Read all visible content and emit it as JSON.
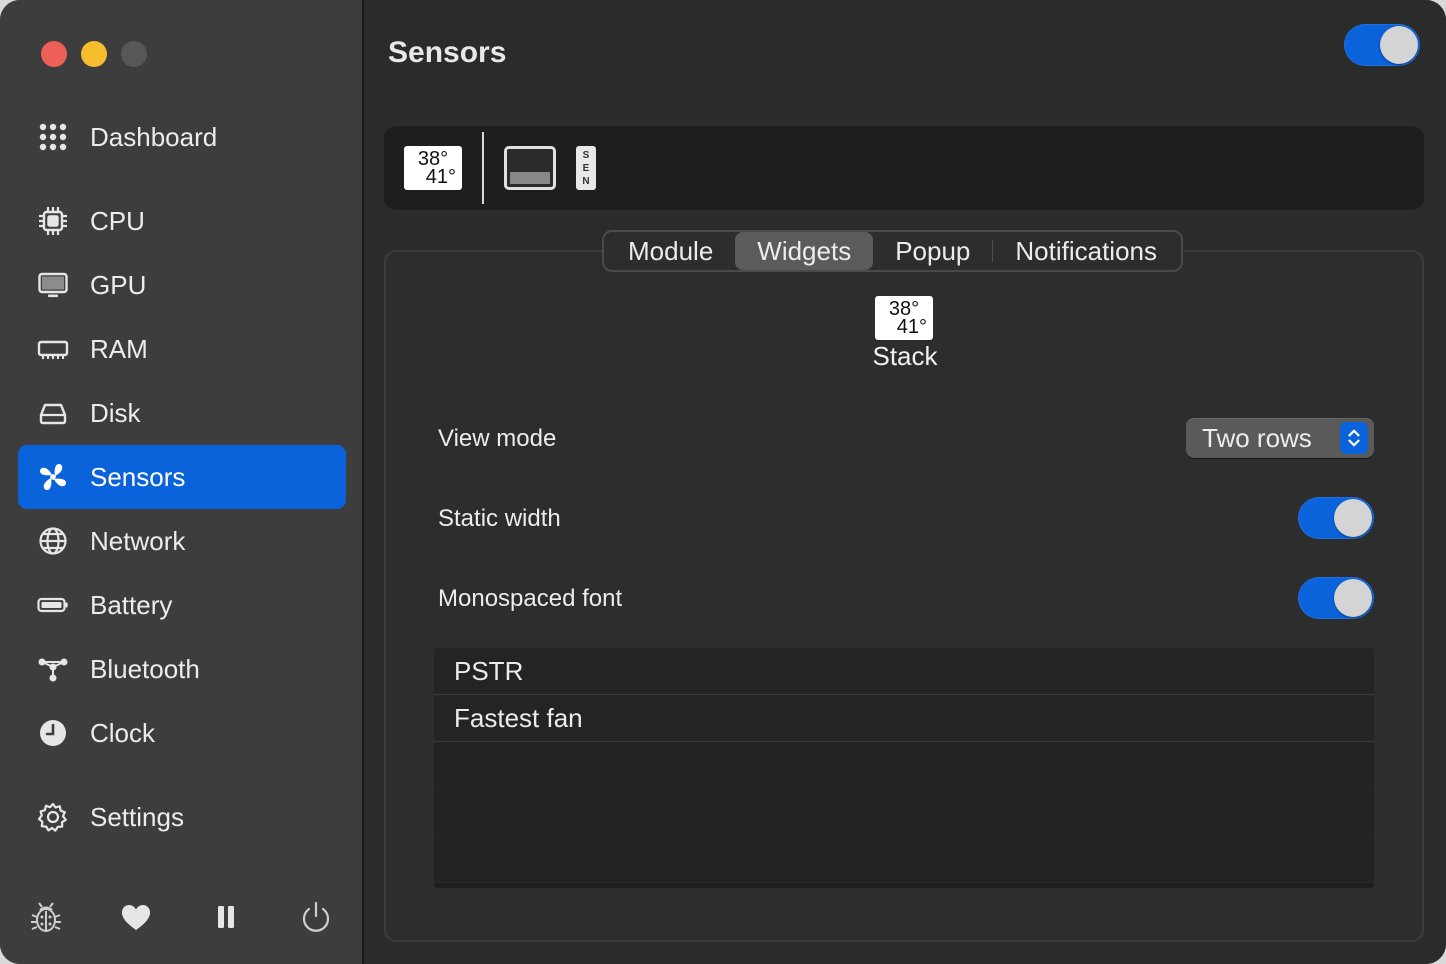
{
  "window": {
    "traffic_lights": [
      "close",
      "minimize",
      "zoom"
    ]
  },
  "sidebar": {
    "items": [
      {
        "label": "Dashboard",
        "icon": "grid-icon"
      },
      {
        "label": "CPU",
        "icon": "chip-icon"
      },
      {
        "label": "GPU",
        "icon": "monitor-icon"
      },
      {
        "label": "RAM",
        "icon": "memory-icon"
      },
      {
        "label": "Disk",
        "icon": "disk-icon"
      },
      {
        "label": "Sensors",
        "icon": "fan-icon",
        "active": true
      },
      {
        "label": "Network",
        "icon": "globe-icon"
      },
      {
        "label": "Battery",
        "icon": "battery-icon"
      },
      {
        "label": "Bluetooth",
        "icon": "bluetooth-nodes-icon"
      },
      {
        "label": "Clock",
        "icon": "clock-icon"
      },
      {
        "label": "Settings",
        "icon": "gear-icon"
      }
    ],
    "bottom_icons": [
      "bug-icon",
      "heart-icon",
      "pause-icon",
      "power-icon"
    ]
  },
  "main": {
    "title": "Sensors",
    "module_enabled": true,
    "widget_bar": {
      "stack_top": "38°",
      "stack_bottom": "41°",
      "label_widget_text": [
        "S",
        "E",
        "N"
      ]
    },
    "tabs": [
      {
        "label": "Module"
      },
      {
        "label": "Widgets",
        "active": true
      },
      {
        "label": "Popup"
      },
      {
        "label": "Notifications"
      }
    ],
    "preview": {
      "top": "38°",
      "bottom": "41°",
      "name": "Stack"
    },
    "settings": {
      "view_mode_label": "View mode",
      "view_mode_value": "Two rows",
      "static_width_label": "Static width",
      "static_width_on": true,
      "monospaced_label": "Monospaced font",
      "monospaced_on": true
    },
    "list": [
      "PSTR",
      "Fastest fan"
    ]
  },
  "colors": {
    "accent": "#0b63db",
    "sidebar_bg": "#3d3d3d",
    "main_bg": "#2b2b2b"
  }
}
